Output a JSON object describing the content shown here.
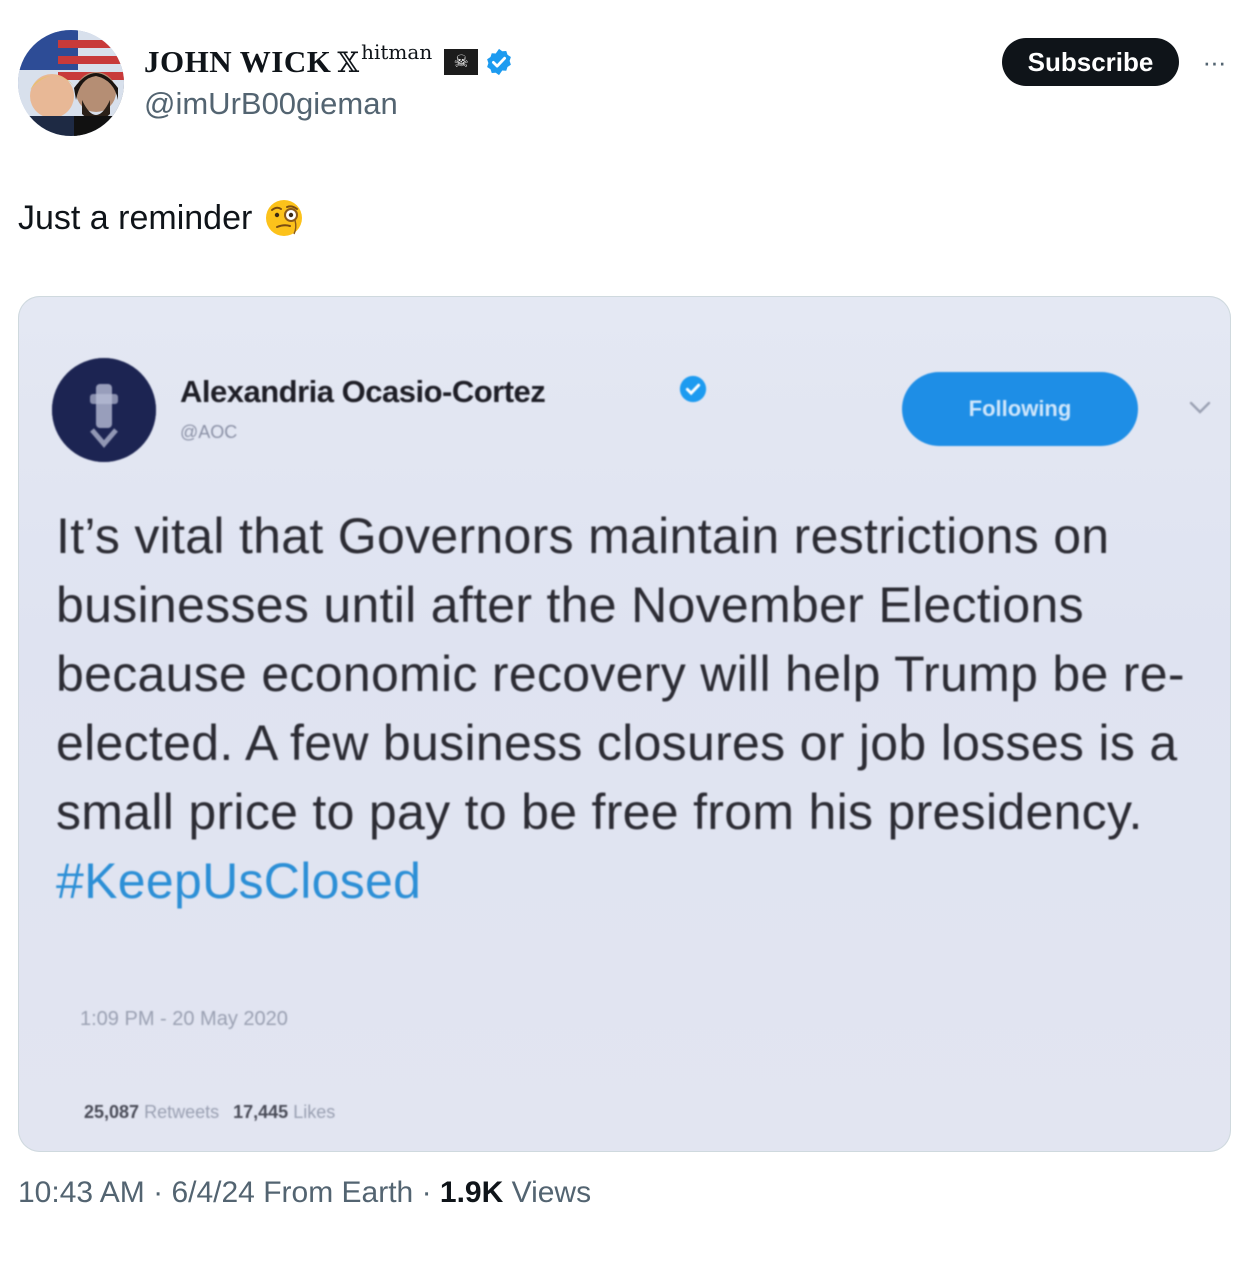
{
  "author": {
    "display_name": "JOHN WICK",
    "name_x_glyph": "𝕏",
    "name_suffix": "hitman",
    "handle": "@imUrB00gieman",
    "pirate_flag": "☠"
  },
  "actions": {
    "subscribe_label": "Subscribe",
    "more_label": "···"
  },
  "post": {
    "text": "Just a reminder"
  },
  "embedded_tweet": {
    "name": "Alexandria Ocasio-Cortez",
    "handle": "@AOC",
    "following_label": "Following",
    "body_main": "It’s vital that Governors maintain restrictions on businesses until after the November Elections because economic recovery will help Trump be re-elected. A few business closures or job losses is a small price to pay to be free from his presidency. ",
    "hashtag": "#KeepUsClosed",
    "timestamp": "1:09 PM - 20 May 2020",
    "retweets_count": "25,087",
    "retweets_label": "Retweets",
    "likes_count": "17,445",
    "likes_label": "Likes"
  },
  "meta": {
    "time": "10:43 AM",
    "sep1": " · ",
    "date": "6/4/24",
    "source": " From Earth",
    "sep2": " · ",
    "views_count": "1.9K",
    "views_label": " Views"
  },
  "colors": {
    "verified_blue": "#1d9bf0",
    "subscribe_bg": "#0f1419",
    "secondary_text": "#536471",
    "hashtag": "#2c8fd6"
  }
}
